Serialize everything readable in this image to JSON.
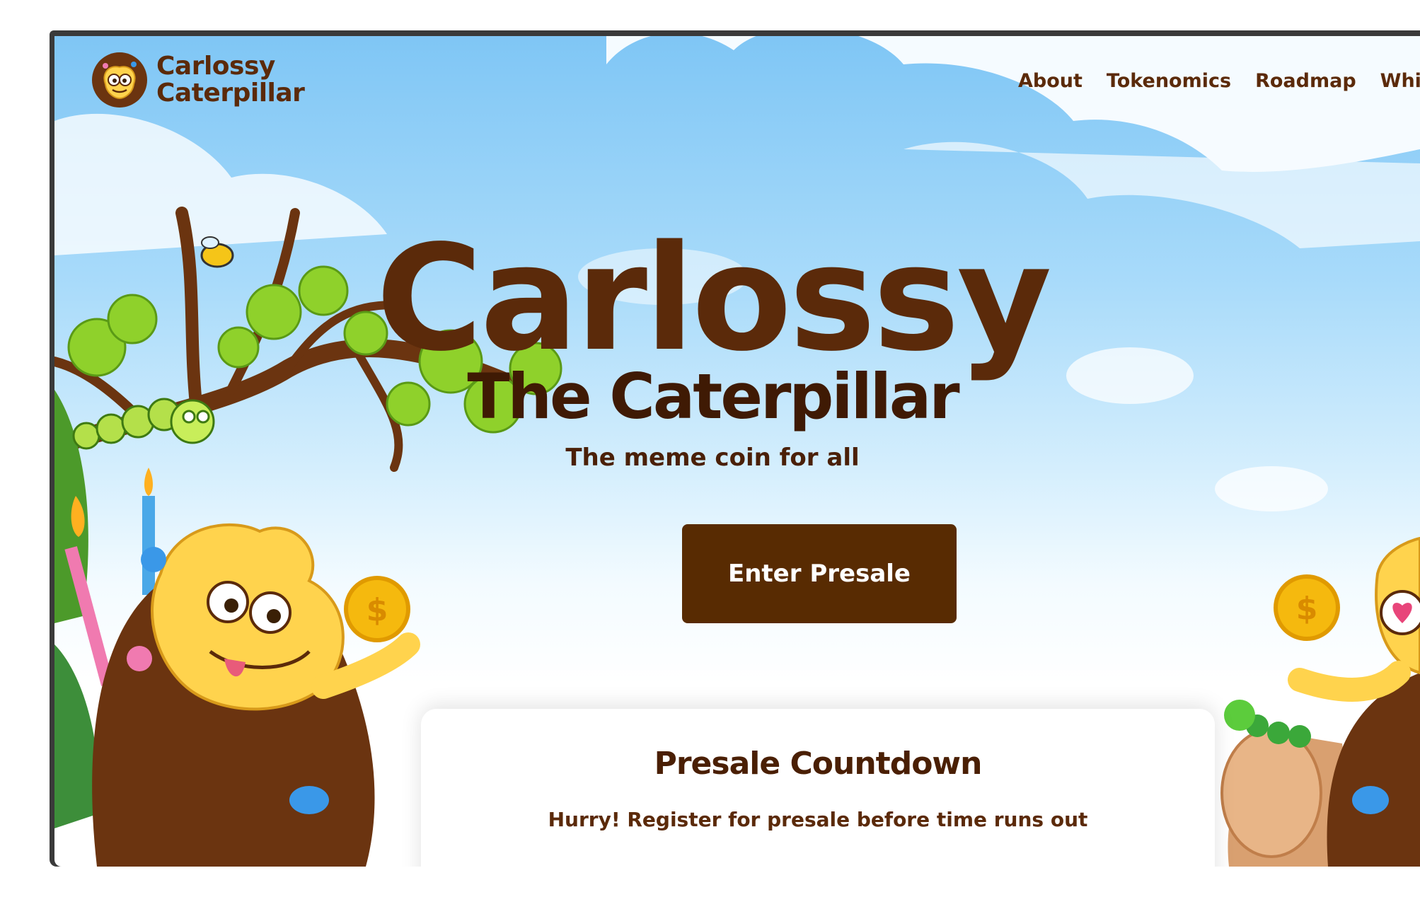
{
  "brand": {
    "line1": "Carlossy",
    "line2": "Caterpillar"
  },
  "nav": {
    "items": [
      "About",
      "Tokenomics",
      "Roadmap",
      "White"
    ]
  },
  "hero": {
    "title": "Carlossy",
    "subtitle": "The Caterpillar",
    "tagline": "The meme coin for all",
    "cta_label": "Enter Presale"
  },
  "countdown": {
    "title": "Presale Countdown",
    "text": "Hurry! Register for presale before time runs out"
  },
  "colors": {
    "brand_brown": "#582b02",
    "text_brown": "#5b2a0a",
    "sky_top": "#7fc6f5",
    "leaf_green": "#8fd12b",
    "mascot_yellow": "#ffd34d",
    "coin_gold": "#f5b90e"
  }
}
